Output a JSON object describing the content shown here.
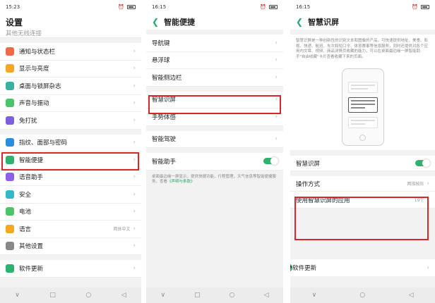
{
  "screens": [
    {
      "status": {
        "time": "15:23",
        "signal": "5dl 5dl ≋ ⊘",
        "alarm": "⏰"
      },
      "title": "设置",
      "partial_top": "其他无线连接",
      "groups": [
        [
          {
            "label": "通知与状态栏",
            "icon": "notification-icon",
            "color": "#f06a4a"
          },
          {
            "label": "显示与亮度",
            "icon": "brightness-icon",
            "color": "#f5a623"
          },
          {
            "label": "桌面与锁屏杂志",
            "icon": "wallpaper-icon",
            "color": "#3ab0a3"
          },
          {
            "label": "声音与振动",
            "icon": "sound-icon",
            "color": "#4cc46b"
          },
          {
            "label": "免打扰",
            "icon": "moon-icon",
            "color": "#7d5de0"
          }
        ],
        [
          {
            "label": "指纹、面部与密码",
            "icon": "fingerprint-icon",
            "color": "#2a8de0"
          },
          {
            "label": "智能便捷",
            "icon": "smart-icon",
            "color": "#2db36f"
          },
          {
            "label": "语音助手",
            "icon": "mic-icon",
            "color": "#8e5fe8"
          },
          {
            "label": "安全",
            "icon": "shield-icon",
            "color": "#32b8c8"
          },
          {
            "label": "电池",
            "icon": "battery-icon",
            "color": "#4cc46b"
          },
          {
            "label": "语言",
            "icon": "language-icon",
            "color": "#f5a623",
            "value": "简体中文"
          },
          {
            "label": "其他设置",
            "icon": "gear-icon",
            "color": "#888888"
          }
        ],
        [
          {
            "label": "软件更新",
            "icon": "update-icon",
            "color": "#2db36f"
          }
        ]
      ]
    },
    {
      "status": {
        "time": "16:15",
        "signal": "5dl 5dl ≋ ⊘",
        "alarm": "⏰"
      },
      "title": "智能便捷",
      "groups": [
        [
          {
            "label": "导航键"
          },
          {
            "label": "悬浮球"
          },
          {
            "label": "智能侧边栏"
          }
        ],
        [
          {
            "label": "智慧识屏"
          },
          {
            "label": "手势体感"
          }
        ],
        [
          {
            "label": "智能驾驶"
          }
        ],
        [
          {
            "label": "智能助手",
            "toggle": true
          }
        ]
      ],
      "desc": "桌面最边缘一屏显示，提供快捷功能，行程管理，天气信息等智能便捷服务，查看",
      "desc_link": "《声明与条款》"
    },
    {
      "status": {
        "time": "16:15",
        "signal": "5dl 5dl ≋ ⊘",
        "alarm": "⏰"
      },
      "title": "智慧识屏",
      "desc": "智慧识屏是一种创新性的识别文本和图像的产品，可快速提供地址、美食、影视、快递、航班、车次和短口令、体育赛事等信息服务，同时还提供对各个应用内文章、视频、商品详情页收藏的能力，可以在桌面最边缘一屏智能助手\"自由收藏\"卡片查看收藏下来的页面。",
      "rows": [
        {
          "label": "智慧识屏",
          "toggle": true
        },
        {
          "label": "操作方式",
          "value": "两指按压"
        },
        {
          "label": "使用智慧识屏的应用",
          "value": "19个"
        }
      ],
      "overlap_label": "软件更新"
    }
  ],
  "navbar": {
    "menu": "∨",
    "home": "○",
    "square": "□",
    "back": "◁"
  }
}
